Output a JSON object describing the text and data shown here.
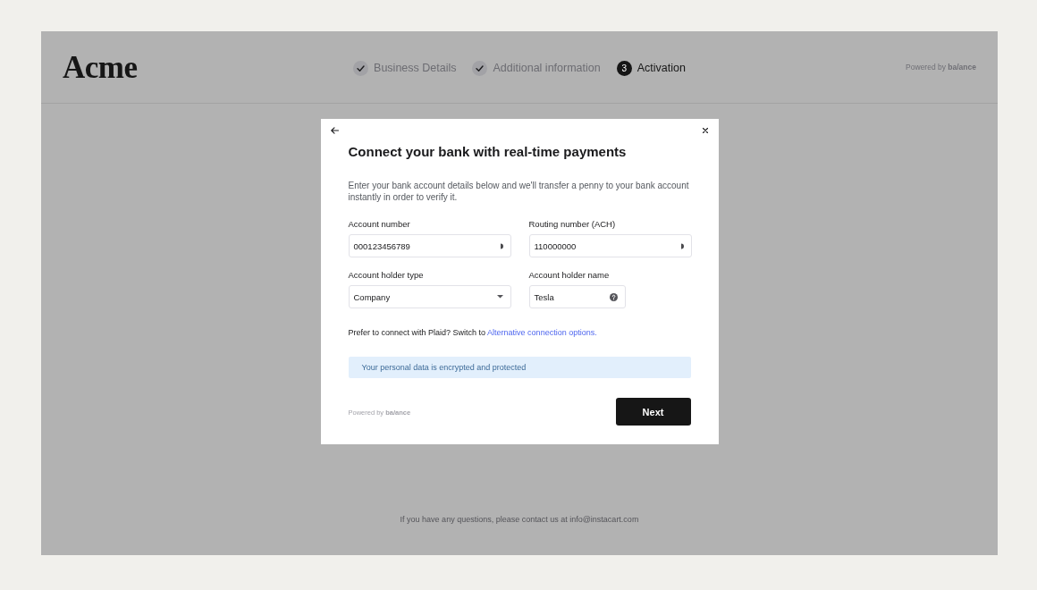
{
  "header": {
    "logo": "Acme",
    "steps": [
      {
        "label": "Business Details",
        "completed": true
      },
      {
        "label": "Additional information",
        "completed": true
      },
      {
        "label": "Activation",
        "completed": false,
        "number": "3"
      }
    ],
    "powered_by": "Powered by **ba/ance**"
  },
  "modal": {
    "title": "Connect your bank with real-time payments",
    "description": "Enter your bank account details below and we'll transfer a penny to your bank account instantly in order to verify it.",
    "fields": [
      {
        "label": "Account number",
        "value": "000123456789",
        "kind": "autofill"
      },
      {
        "label": "Routing number (ACH)",
        "value": "110000000",
        "kind": "autofill"
      },
      {
        "label": "Account holder type",
        "value": "Company",
        "kind": "select"
      },
      {
        "label": "Account holder name",
        "value": "Tesla",
        "kind": "help"
      }
    ],
    "plaid_prompt": {
      "text": "Prefer to connect with Plaid? Switch to",
      "link": "Alternative connection options."
    },
    "notice": "Your personal data is encrypted and protected",
    "powered_by": "Powered by **ba/ance**",
    "next_button": "Next"
  },
  "footer": {
    "contact": "If you have any questions, please contact us at info@instacart.com"
  }
}
